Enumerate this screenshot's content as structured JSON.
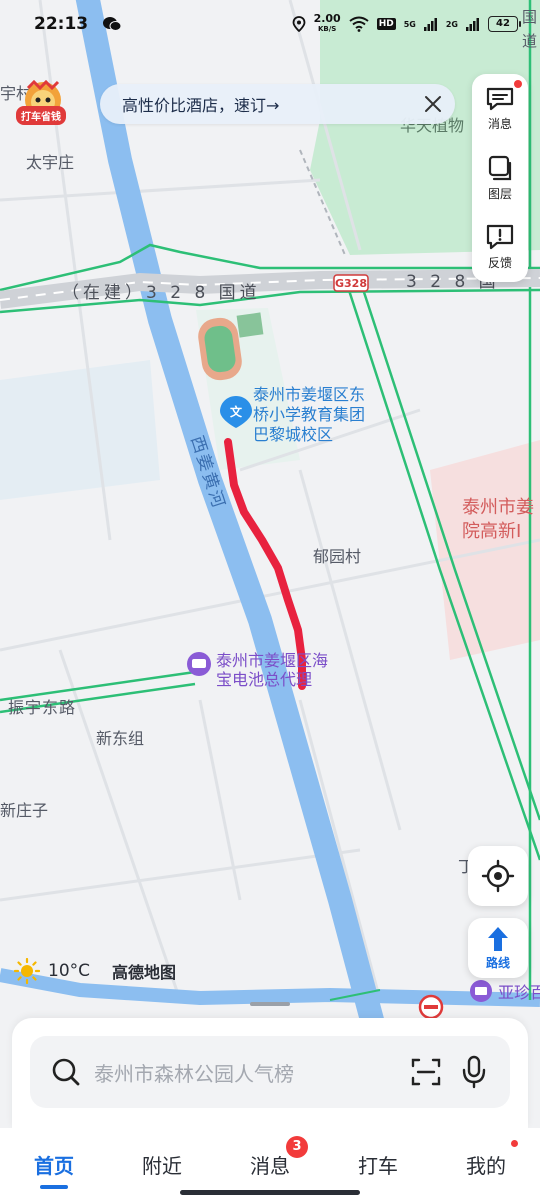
{
  "status_bar": {
    "time": "22:13",
    "net_speed_value": "2.00",
    "net_speed_unit": "KB/S",
    "hd_label": "HD",
    "sig1_label": "5G",
    "sig2_label": "2G",
    "battery": "42"
  },
  "promo": {
    "text": "高性价比酒店，速订→"
  },
  "lion_badge": {
    "label": "打车省钱"
  },
  "tools": {
    "message_label": "消息",
    "layers_label": "图层",
    "feedback_label": "反馈",
    "route_label": "路线"
  },
  "map_labels": {
    "village_1": "太宇庄",
    "village_top_left": "宇村",
    "road_328": "（在建）3 2 8 国道",
    "road_328_right": "3 2 8 国",
    "road_badge": "G328",
    "river": "西姜黄河",
    "school_line1": "泰州市姜堰区东",
    "school_line2": "桥小学教育集团",
    "school_line3": "巴黎城校区",
    "yuyuan": "郁园村",
    "pink_line1": "泰州市姜",
    "pink_line2": "院高新I",
    "repair_line1": "泰州市姜堰区海",
    "repair_line2": "宝电池总代理",
    "zhenyu_road": "振宇东路",
    "xindong": "新东组",
    "xinzhuangzi": "新庄子",
    "plant_label": "华天植物",
    "top_right_road_1": "国",
    "top_right_road_2": "道",
    "yazhen": "亚珍百",
    "right_ding": "丁"
  },
  "weather": {
    "temp": "10°C",
    "brand": "高德地图"
  },
  "search": {
    "placeholder": "泰州市森林公园人气榜"
  },
  "nav": {
    "items": [
      {
        "label": "首页"
      },
      {
        "label": "附近"
      },
      {
        "label": "消息"
      },
      {
        "label": "打车"
      },
      {
        "label": "我的"
      }
    ],
    "message_badge": "3"
  },
  "colors": {
    "accent": "#1a6fe0",
    "river": "#8cbef0",
    "route_red": "#e8223f",
    "green_area": "#c5ead0",
    "badge_red": "#f23b3b"
  }
}
